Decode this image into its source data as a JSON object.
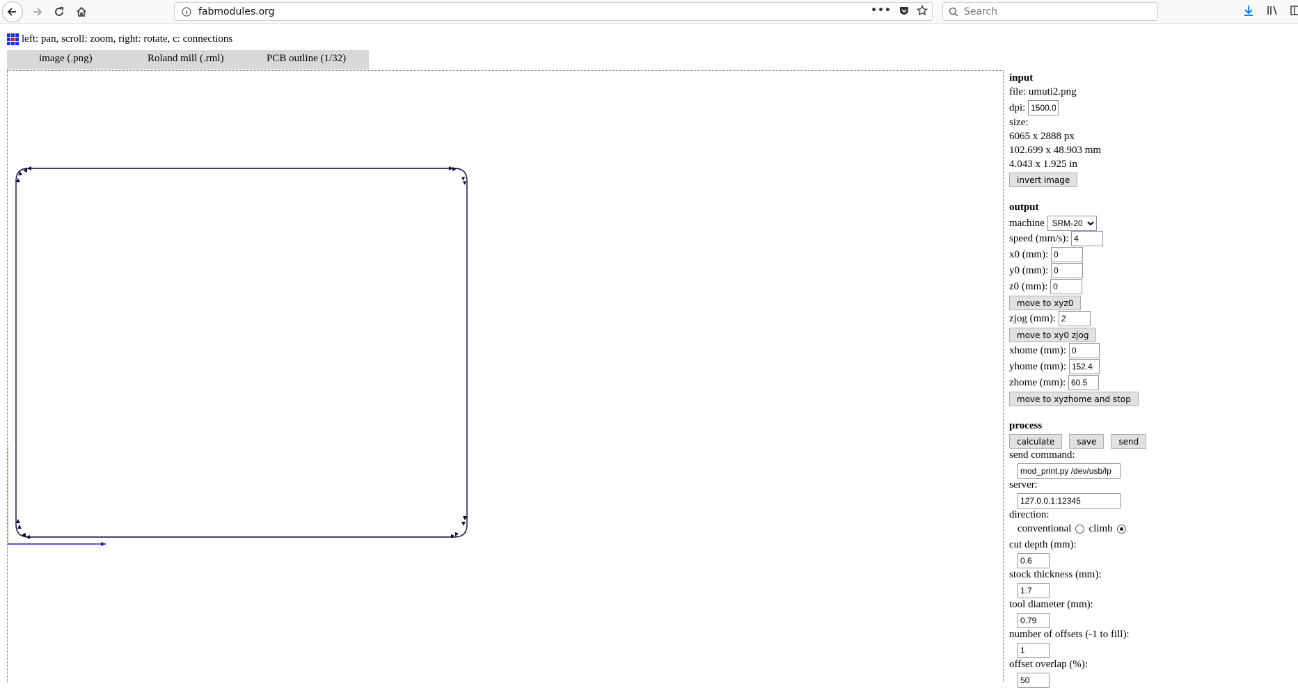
{
  "browser": {
    "url": "fabmodules.org",
    "search_placeholder": "Search"
  },
  "help_text": "left: pan, scroll: zoom, right: rotate, c: connections",
  "tabs": [
    {
      "label": "image (.png)"
    },
    {
      "label": "Roland mill (.rml)"
    },
    {
      "label": "PCB outline (1/32)"
    }
  ],
  "input": {
    "heading": "input",
    "file_label": "file:",
    "file_name": "umuti2.png",
    "dpi_label": "dpi:",
    "dpi_value": "1500.0",
    "size_label": "size:",
    "size_px": "6065 x 2888 px",
    "size_mm": "102.699 x 48.903 mm",
    "size_in": "4.043 x 1.925 in",
    "invert_label": "invert image"
  },
  "output": {
    "heading": "output",
    "machine_label": "machine",
    "machine_value": "SRM-20",
    "speed_label": "speed (mm/s):",
    "speed_value": "4",
    "x0_label": "x0 (mm):",
    "x0_value": "0",
    "y0_label": "y0 (mm):",
    "y0_value": "0",
    "z0_label": "z0 (mm):",
    "z0_value": "0",
    "move_xyz0_label": "move to xyz0",
    "zjog_label": "zjog (mm):",
    "zjog_value": "2",
    "move_xy0_zjog_label": "move to xy0 zjog",
    "xhome_label": "xhome (mm):",
    "xhome_value": "0",
    "yhome_label": "yhome (mm):",
    "yhome_value": "152.4",
    "zhome_label": "zhome (mm):",
    "zhome_value": "60.5",
    "move_home_label": "move to xyzhome and stop"
  },
  "process": {
    "heading": "process",
    "calculate_label": "calculate",
    "save_label": "save",
    "send_label": "send",
    "send_command_label": "send command:",
    "send_command_value": "mod_print.py /dev/usb/lp",
    "server_label": "server:",
    "server_value": "127.0.0.1:12345",
    "direction_label": "direction:",
    "conventional_label": "conventional",
    "climb_label": "climb",
    "direction_selected": "climb",
    "cut_depth_label": "cut depth (mm):",
    "cut_depth_value": "0.6",
    "stock_label": "stock thickness (mm):",
    "stock_value": "1.7",
    "tool_label": "tool diameter (mm):",
    "tool_value": "0.79",
    "offsets_label": "number of offsets (-1 to fill):",
    "offsets_value": "1",
    "overlap_label": "offset overlap (%):",
    "overlap_value": "50"
  },
  "colors": {
    "path": "#0a0a3a",
    "axis_x": "#2222cc",
    "axis_y": "#22aa22",
    "logo_blue": "#1a2ed8",
    "logo_red": "#d81a1a"
  }
}
